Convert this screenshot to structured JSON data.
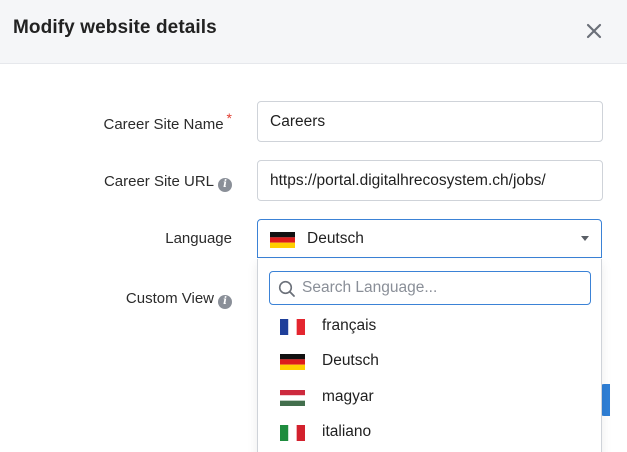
{
  "dialog": {
    "title": "Modify website details",
    "close_icon": "close-icon"
  },
  "form": {
    "career_site_name": {
      "label": "Career Site Name",
      "required_marker": "*",
      "value": "Careers"
    },
    "career_site_url": {
      "label": "Career Site URL",
      "info_icon": "info-icon",
      "value": "https://portal.digitalhrecosystem.ch/jobs/"
    },
    "language": {
      "label": "Language",
      "value": "Deutsch",
      "flag_icon": "germany-flag-icon",
      "caret_icon": "chevron-down-icon"
    },
    "custom_view": {
      "label": "Custom View",
      "info_icon": "info-icon"
    }
  },
  "language_dropdown": {
    "search_placeholder": "Search Language...",
    "search_icon": "search-icon",
    "options": [
      {
        "label": "français",
        "flag_icon": "france-flag-icon"
      },
      {
        "label": "Deutsch",
        "flag_icon": "germany-flag-icon"
      },
      {
        "label": "magyar",
        "flag_icon": "hungary-flag-icon"
      },
      {
        "label": "italiano",
        "flag_icon": "italy-flag-icon"
      }
    ]
  },
  "colors": {
    "accent": "#3b82d6",
    "required": "#e03b2e",
    "header_bg": "#f5f6f8"
  }
}
